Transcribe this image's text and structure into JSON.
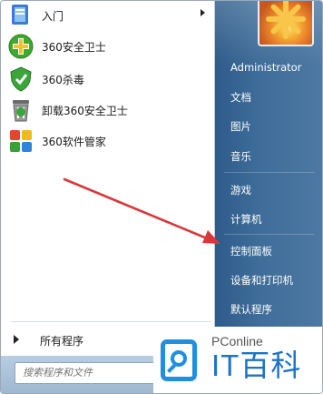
{
  "programs": [
    {
      "label": "入门",
      "icon": "getting-started-icon",
      "has_submenu": true
    },
    {
      "label": "360安全卫士",
      "icon": "360-security-icon"
    },
    {
      "label": "360杀毒",
      "icon": "360-antivirus-icon"
    },
    {
      "label": "卸载360安全卫士",
      "icon": "uninstall-icon"
    },
    {
      "label": "360软件管家",
      "icon": "360-software-manager-icon"
    }
  ],
  "all_programs": {
    "label": "所有程序"
  },
  "search": {
    "placeholder": "搜索程序和文件"
  },
  "right_menu": {
    "user": "Administrator",
    "items": [
      "文档",
      "图片",
      "音乐",
      "游戏",
      "计算机",
      "控制面板",
      "设备和打印机",
      "默认程序"
    ]
  },
  "watermark": {
    "small": "PConline",
    "big": "IT百科"
  },
  "colors": {
    "right_pane": "#3f6d99",
    "arrow": "#d9383a",
    "watermark_blue": "#1b74c7"
  }
}
